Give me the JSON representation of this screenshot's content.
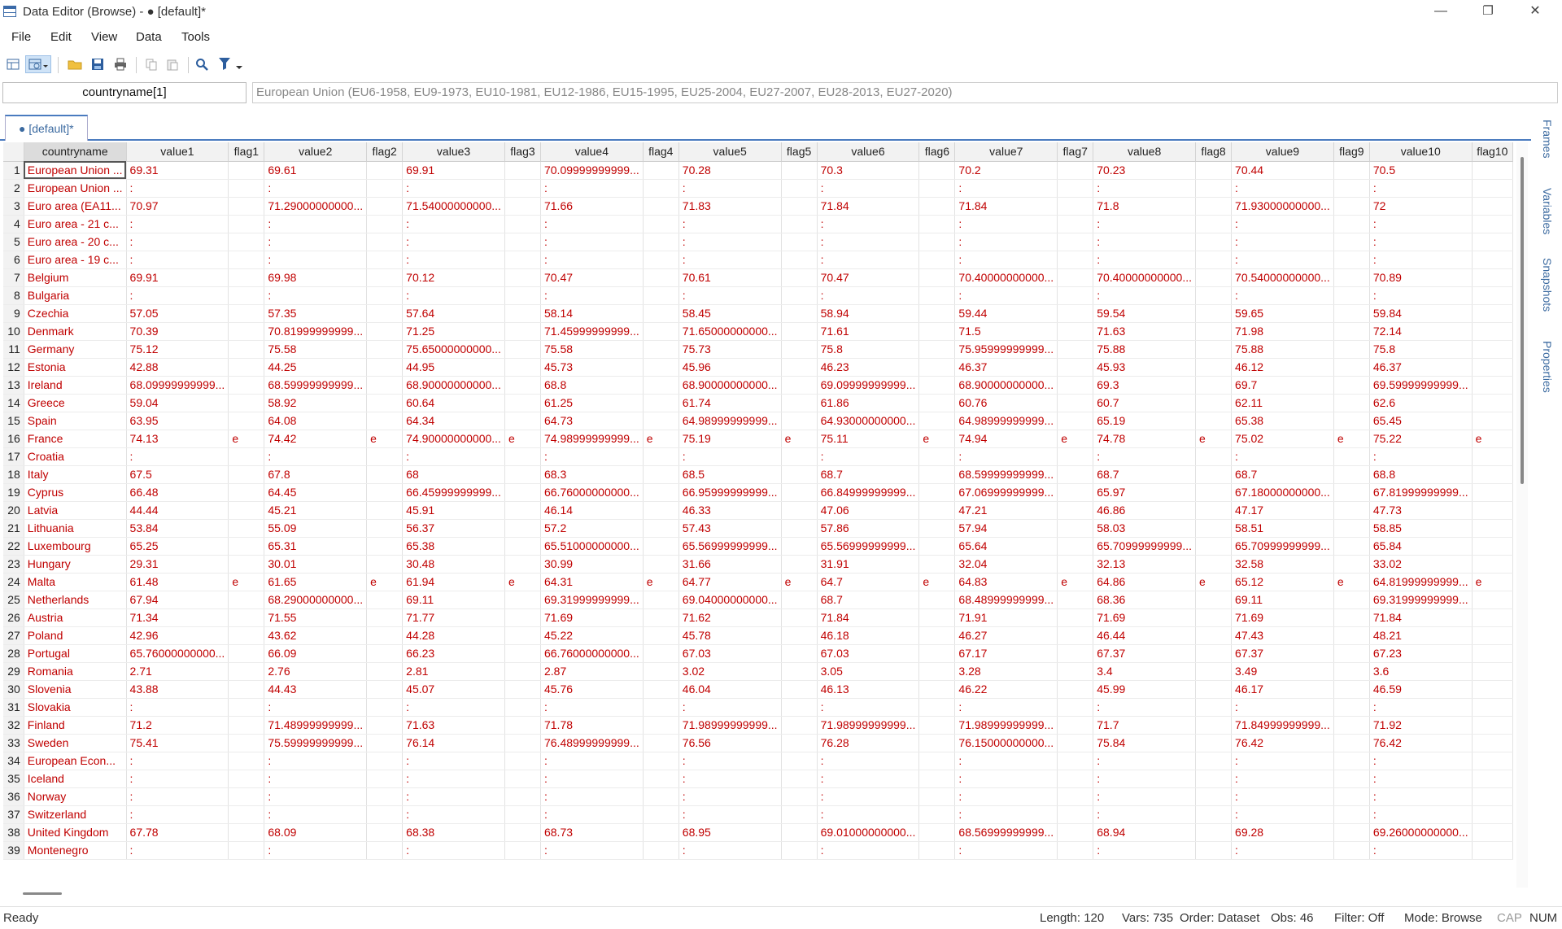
{
  "window": {
    "title": "Data Editor (Browse) - ● [default]*",
    "minimize": "—",
    "restore": "❐",
    "close": "✕"
  },
  "menu": [
    "File",
    "Edit",
    "View",
    "Data",
    "Tools"
  ],
  "toolbar": {
    "icons": [
      "data-editor-edit-icon",
      "data-editor-browse-icon",
      "open-folder-icon",
      "save-icon",
      "print-icon",
      "copy-icon",
      "paste-icon",
      "search-icon",
      "filter-icon"
    ]
  },
  "varname": "countryname[1]",
  "cell_value": "European Union (EU6-1958, EU9-1973, EU10-1981, EU12-1986, EU15-1995, EU25-2004, EU27-2007, EU28-2013, EU27-2020)",
  "frame_tab": "● [default]*",
  "columns": [
    "countryname",
    "value1",
    "flag1",
    "value2",
    "flag2",
    "value3",
    "flag3",
    "value4",
    "flag4",
    "value5",
    "flag5",
    "value6",
    "flag6",
    "value7",
    "flag7",
    "value8",
    "flag8",
    "value9",
    "flag9",
    "value10",
    "flag10"
  ],
  "rows": [
    [
      "1",
      "European Union ...",
      "69.31",
      "",
      "69.61",
      "",
      "69.91",
      "",
      "70.09999999999...",
      "",
      "70.28",
      "",
      "70.3",
      "",
      "70.2",
      "",
      "70.23",
      "",
      "70.44",
      "",
      "70.5",
      ""
    ],
    [
      "2",
      "European Union ...",
      ":",
      "",
      ":",
      "",
      ":",
      "",
      ":",
      "",
      ":",
      "",
      ":",
      "",
      ":",
      "",
      ":",
      "",
      ":",
      "",
      ":",
      ""
    ],
    [
      "3",
      "Euro area (EA11...",
      "70.97",
      "",
      "71.29000000000...",
      "",
      "71.54000000000...",
      "",
      "71.66",
      "",
      "71.83",
      "",
      "71.84",
      "",
      "71.84",
      "",
      "71.8",
      "",
      "71.93000000000...",
      "",
      "72",
      ""
    ],
    [
      "4",
      "Euro area - 21 c...",
      ":",
      "",
      ":",
      "",
      ":",
      "",
      ":",
      "",
      ":",
      "",
      ":",
      "",
      ":",
      "",
      ":",
      "",
      ":",
      "",
      ":",
      ""
    ],
    [
      "5",
      "Euro area - 20 c...",
      ":",
      "",
      ":",
      "",
      ":",
      "",
      ":",
      "",
      ":",
      "",
      ":",
      "",
      ":",
      "",
      ":",
      "",
      ":",
      "",
      ":",
      ""
    ],
    [
      "6",
      "Euro area - 19 c...",
      ":",
      "",
      ":",
      "",
      ":",
      "",
      ":",
      "",
      ":",
      "",
      ":",
      "",
      ":",
      "",
      ":",
      "",
      ":",
      "",
      ":",
      ""
    ],
    [
      "7",
      "Belgium",
      "69.91",
      "",
      "69.98",
      "",
      "70.12",
      "",
      "70.47",
      "",
      "70.61",
      "",
      "70.47",
      "",
      "70.40000000000...",
      "",
      "70.40000000000...",
      "",
      "70.54000000000...",
      "",
      "70.89",
      ""
    ],
    [
      "8",
      "Bulgaria",
      ":",
      "",
      ":",
      "",
      ":",
      "",
      ":",
      "",
      ":",
      "",
      ":",
      "",
      ":",
      "",
      ":",
      "",
      ":",
      "",
      ":",
      ""
    ],
    [
      "9",
      "Czechia",
      "57.05",
      "",
      "57.35",
      "",
      "57.64",
      "",
      "58.14",
      "",
      "58.45",
      "",
      "58.94",
      "",
      "59.44",
      "",
      "59.54",
      "",
      "59.65",
      "",
      "59.84",
      ""
    ],
    [
      "10",
      "Denmark",
      "70.39",
      "",
      "70.81999999999...",
      "",
      "71.25",
      "",
      "71.45999999999...",
      "",
      "71.65000000000...",
      "",
      "71.61",
      "",
      "71.5",
      "",
      "71.63",
      "",
      "71.98",
      "",
      "72.14",
      ""
    ],
    [
      "11",
      "Germany",
      "75.12",
      "",
      "75.58",
      "",
      "75.65000000000...",
      "",
      "75.58",
      "",
      "75.73",
      "",
      "75.8",
      "",
      "75.95999999999...",
      "",
      "75.88",
      "",
      "75.88",
      "",
      "75.8",
      ""
    ],
    [
      "12",
      "Estonia",
      "42.88",
      "",
      "44.25",
      "",
      "44.95",
      "",
      "45.73",
      "",
      "45.96",
      "",
      "46.23",
      "",
      "46.37",
      "",
      "45.93",
      "",
      "46.12",
      "",
      "46.37",
      ""
    ],
    [
      "13",
      "Ireland",
      "68.09999999999...",
      "",
      "68.59999999999...",
      "",
      "68.90000000000...",
      "",
      "68.8",
      "",
      "68.90000000000...",
      "",
      "69.09999999999...",
      "",
      "68.90000000000...",
      "",
      "69.3",
      "",
      "69.7",
      "",
      "69.59999999999...",
      ""
    ],
    [
      "14",
      "Greece",
      "59.04",
      "",
      "58.92",
      "",
      "60.64",
      "",
      "61.25",
      "",
      "61.74",
      "",
      "61.86",
      "",
      "60.76",
      "",
      "60.7",
      "",
      "62.11",
      "",
      "62.6",
      ""
    ],
    [
      "15",
      "Spain",
      "63.95",
      "",
      "64.08",
      "",
      "64.34",
      "",
      "64.73",
      "",
      "64.98999999999...",
      "",
      "64.93000000000...",
      "",
      "64.98999999999...",
      "",
      "65.19",
      "",
      "65.38",
      "",
      "65.45",
      ""
    ],
    [
      "16",
      "France",
      "74.13",
      "e",
      "74.42",
      "e",
      "74.90000000000...",
      "e",
      "74.98999999999...",
      "e",
      "75.19",
      "e",
      "75.11",
      "e",
      "74.94",
      "e",
      "74.78",
      "e",
      "75.02",
      "e",
      "75.22",
      "e"
    ],
    [
      "17",
      "Croatia",
      ":",
      "",
      ":",
      "",
      ":",
      "",
      ":",
      "",
      ":",
      "",
      ":",
      "",
      ":",
      "",
      ":",
      "",
      ":",
      "",
      ":",
      ""
    ],
    [
      "18",
      "Italy",
      "67.5",
      "",
      "67.8",
      "",
      "68",
      "",
      "68.3",
      "",
      "68.5",
      "",
      "68.7",
      "",
      "68.59999999999...",
      "",
      "68.7",
      "",
      "68.7",
      "",
      "68.8",
      ""
    ],
    [
      "19",
      "Cyprus",
      "66.48",
      "",
      "64.45",
      "",
      "66.45999999999...",
      "",
      "66.76000000000...",
      "",
      "66.95999999999...",
      "",
      "66.84999999999...",
      "",
      "67.06999999999...",
      "",
      "65.97",
      "",
      "67.18000000000...",
      "",
      "67.81999999999...",
      ""
    ],
    [
      "20",
      "Latvia",
      "44.44",
      "",
      "45.21",
      "",
      "45.91",
      "",
      "46.14",
      "",
      "46.33",
      "",
      "47.06",
      "",
      "47.21",
      "",
      "46.86",
      "",
      "47.17",
      "",
      "47.73",
      ""
    ],
    [
      "21",
      "Lithuania",
      "53.84",
      "",
      "55.09",
      "",
      "56.37",
      "",
      "57.2",
      "",
      "57.43",
      "",
      "57.86",
      "",
      "57.94",
      "",
      "58.03",
      "",
      "58.51",
      "",
      "58.85",
      ""
    ],
    [
      "22",
      "Luxembourg",
      "65.25",
      "",
      "65.31",
      "",
      "65.38",
      "",
      "65.51000000000...",
      "",
      "65.56999999999...",
      "",
      "65.56999999999...",
      "",
      "65.64",
      "",
      "65.70999999999...",
      "",
      "65.70999999999...",
      "",
      "65.84",
      ""
    ],
    [
      "23",
      "Hungary",
      "29.31",
      "",
      "30.01",
      "",
      "30.48",
      "",
      "30.99",
      "",
      "31.66",
      "",
      "31.91",
      "",
      "32.04",
      "",
      "32.13",
      "",
      "32.58",
      "",
      "33.02",
      ""
    ],
    [
      "24",
      "Malta",
      "61.48",
      "e",
      "61.65",
      "e",
      "61.94",
      "e",
      "64.31",
      "e",
      "64.77",
      "e",
      "64.7",
      "e",
      "64.83",
      "e",
      "64.86",
      "e",
      "65.12",
      "e",
      "64.81999999999...",
      "e"
    ],
    [
      "25",
      "Netherlands",
      "67.94",
      "",
      "68.29000000000...",
      "",
      "69.11",
      "",
      "69.31999999999...",
      "",
      "69.04000000000...",
      "",
      "68.7",
      "",
      "68.48999999999...",
      "",
      "68.36",
      "",
      "69.11",
      "",
      "69.31999999999...",
      ""
    ],
    [
      "26",
      "Austria",
      "71.34",
      "",
      "71.55",
      "",
      "71.77",
      "",
      "71.69",
      "",
      "71.62",
      "",
      "71.84",
      "",
      "71.91",
      "",
      "71.69",
      "",
      "71.69",
      "",
      "71.84",
      ""
    ],
    [
      "27",
      "Poland",
      "42.96",
      "",
      "43.62",
      "",
      "44.28",
      "",
      "45.22",
      "",
      "45.78",
      "",
      "46.18",
      "",
      "46.27",
      "",
      "46.44",
      "",
      "47.43",
      "",
      "48.21",
      ""
    ],
    [
      "28",
      "Portugal",
      "65.76000000000...",
      "",
      "66.09",
      "",
      "66.23",
      "",
      "66.76000000000...",
      "",
      "67.03",
      "",
      "67.03",
      "",
      "67.17",
      "",
      "67.37",
      "",
      "67.37",
      "",
      "67.23",
      ""
    ],
    [
      "29",
      "Romania",
      "2.71",
      "",
      "2.76",
      "",
      "2.81",
      "",
      "2.87",
      "",
      "3.02",
      "",
      "3.05",
      "",
      "3.28",
      "",
      "3.4",
      "",
      "3.49",
      "",
      "3.6",
      ""
    ],
    [
      "30",
      "Slovenia",
      "43.88",
      "",
      "44.43",
      "",
      "45.07",
      "",
      "45.76",
      "",
      "46.04",
      "",
      "46.13",
      "",
      "46.22",
      "",
      "45.99",
      "",
      "46.17",
      "",
      "46.59",
      ""
    ],
    [
      "31",
      "Slovakia",
      ":",
      "",
      ":",
      "",
      ":",
      "",
      ":",
      "",
      ":",
      "",
      ":",
      "",
      ":",
      "",
      ":",
      "",
      ":",
      "",
      ":",
      ""
    ],
    [
      "32",
      "Finland",
      "71.2",
      "",
      "71.48999999999...",
      "",
      "71.63",
      "",
      "71.78",
      "",
      "71.98999999999...",
      "",
      "71.98999999999...",
      "",
      "71.98999999999...",
      "",
      "71.7",
      "",
      "71.84999999999...",
      "",
      "71.92",
      ""
    ],
    [
      "33",
      "Sweden",
      "75.41",
      "",
      "75.59999999999...",
      "",
      "76.14",
      "",
      "76.48999999999...",
      "",
      "76.56",
      "",
      "76.28",
      "",
      "76.15000000000...",
      "",
      "75.84",
      "",
      "76.42",
      "",
      "76.42",
      ""
    ],
    [
      "34",
      "European Econ...",
      ":",
      "",
      ":",
      "",
      ":",
      "",
      ":",
      "",
      ":",
      "",
      ":",
      "",
      ":",
      "",
      ":",
      "",
      ":",
      "",
      ":",
      ""
    ],
    [
      "35",
      "Iceland",
      ":",
      "",
      ":",
      "",
      ":",
      "",
      ":",
      "",
      ":",
      "",
      ":",
      "",
      ":",
      "",
      ":",
      "",
      ":",
      "",
      ":",
      ""
    ],
    [
      "36",
      "Norway",
      ":",
      "",
      ":",
      "",
      ":",
      "",
      ":",
      "",
      ":",
      "",
      ":",
      "",
      ":",
      "",
      ":",
      "",
      ":",
      "",
      ":",
      ""
    ],
    [
      "37",
      "Switzerland",
      ":",
      "",
      ":",
      "",
      ":",
      "",
      ":",
      "",
      ":",
      "",
      ":",
      "",
      ":",
      "",
      ":",
      "",
      ":",
      "",
      ":",
      ""
    ],
    [
      "38",
      "United Kingdom",
      "67.78",
      "",
      "68.09",
      "",
      "68.38",
      "",
      "68.73",
      "",
      "68.95",
      "",
      "69.01000000000...",
      "",
      "68.56999999999...",
      "",
      "68.94",
      "",
      "69.28",
      "",
      "69.26000000000...",
      ""
    ],
    [
      "39",
      "Montenegro",
      ":",
      "",
      ":",
      "",
      ":",
      "",
      ":",
      "",
      ":",
      "",
      ":",
      "",
      ":",
      "",
      ":",
      "",
      ":",
      "",
      ":",
      ""
    ]
  ],
  "side_tabs": [
    "Frames",
    "Variables",
    "Snapshots",
    "Properties"
  ],
  "status": {
    "ready": "Ready",
    "length": "Length: 120",
    "vars": "Vars: 735",
    "order": "Order: Dataset",
    "obs": "Obs: 46",
    "filter": "Filter: Off",
    "mode": "Mode: Browse",
    "cap": "CAP",
    "num": "NUM"
  },
  "colors": {
    "string_text": "#c00000",
    "accent": "#4a7bbf",
    "header_bg": "#f2f2f2"
  }
}
